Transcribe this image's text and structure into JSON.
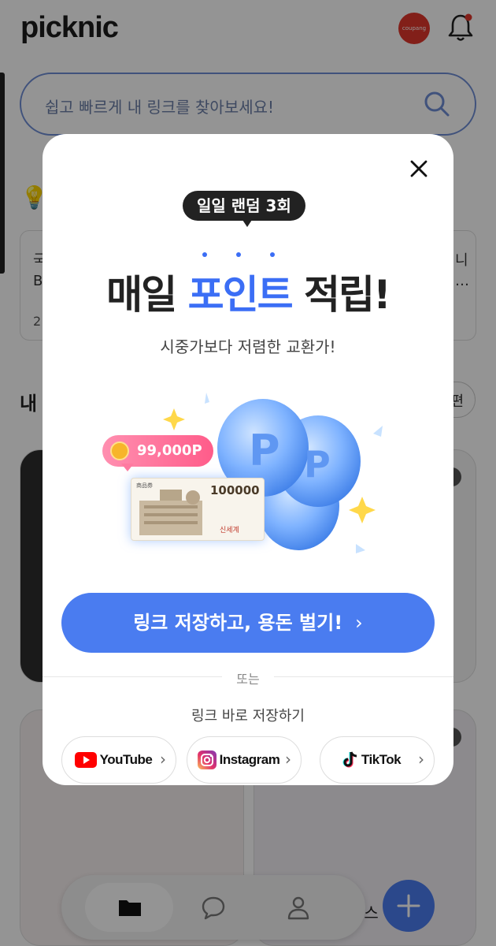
{
  "app": {
    "logo": "picknic",
    "coupang_badge": "coupang",
    "search_placeholder": "쉽고 빠르게 내 링크를 찾아보세요!"
  },
  "background": {
    "card_text_a": "국",
    "card_text_b": "B",
    "card_text_c": "2",
    "card_text_d": "니",
    "card_text_e": "…",
    "section_title": "내",
    "edit_pill": "편",
    "health_label": "헬스"
  },
  "modal": {
    "badge": "일일 랜덤 3회",
    "headline_pre": "매일 ",
    "headline_accent": "포인트",
    "headline_post": " 적립!",
    "subline": "시중가보다 저렴한 교환가!",
    "points_pill": "99,000P",
    "voucher_amount": "100000",
    "voucher_brand": "신세계",
    "voucher_corner": "商品券",
    "cta_label": "링크 저장하고, 용돈 벌기!",
    "cta_chevron": "›",
    "or_text": "또는",
    "direct_text": "링크 바로 저장하기",
    "platforms": [
      {
        "label": "YouTube",
        "icon": "youtube-icon",
        "color": "#ff0000"
      },
      {
        "label": "Instagram",
        "icon": "instagram-icon",
        "color": "#d6249f"
      },
      {
        "label": "TikTok",
        "icon": "tiktok-icon",
        "color": "#111111"
      }
    ],
    "platform_chevron": "›"
  },
  "colors": {
    "accent": "#3b6ef5",
    "cta": "#4a7cf0",
    "badge_bg": "#222222",
    "points_pink": "#ff5c8a"
  }
}
